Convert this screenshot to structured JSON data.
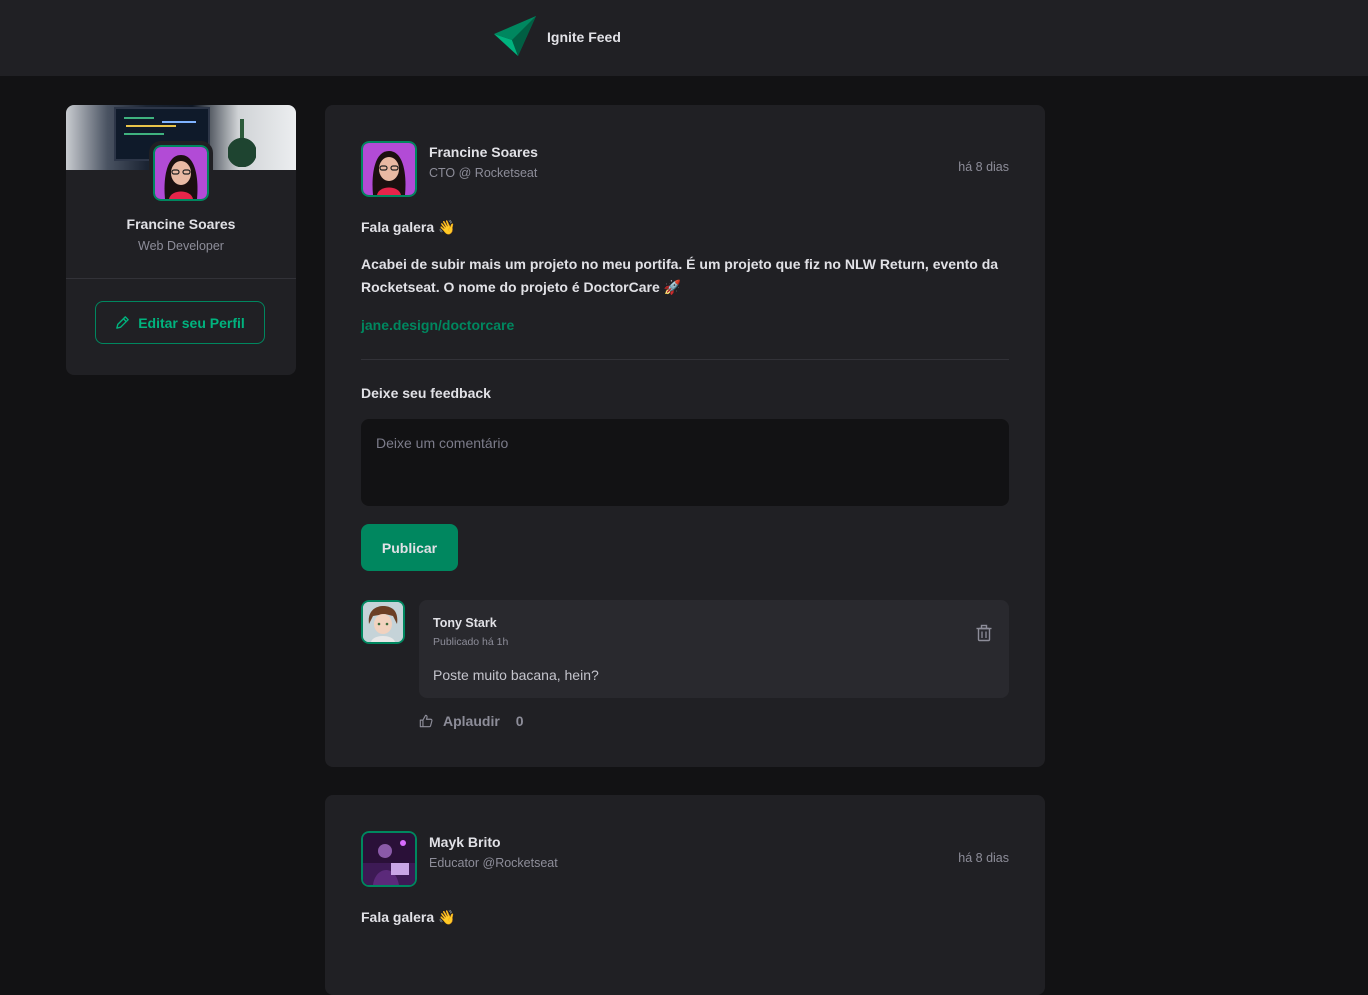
{
  "header": {
    "brand": "Ignite Feed"
  },
  "sidebar": {
    "name": "Francine Soares",
    "role": "Web Developer",
    "edit_label": "Editar seu Perfil"
  },
  "posts": [
    {
      "author": "Francine Soares",
      "role": "CTO @ Rocketseat",
      "time": "há 8 dias",
      "greeting": "Fala galera 👋",
      "body": "Acabei de subir mais um projeto no meu portifa. É um projeto que fiz no NLW Return, evento da Rocketseat. O nome do projeto é DoctorCare 🚀",
      "link": "jane.design/doctorcare",
      "feedback_title": "Deixe seu feedback",
      "comment_placeholder": "Deixe um comentário",
      "publish_label": "Publicar",
      "comments": [
        {
          "author": "Tony Stark",
          "time": "Publicado há 1h",
          "text": "Poste muito bacana, hein?",
          "applaud_label": "Aplaudir",
          "applaud_count": "0"
        }
      ]
    },
    {
      "author": "Mayk Brito",
      "role": "Educator @Rocketseat",
      "time": "há 8 dias",
      "greeting": "Fala galera 👋"
    }
  ],
  "colors": {
    "background": "#121214",
    "surface": "#202024",
    "brand_green": "#00875f",
    "text_muted": "#8d8d99"
  }
}
